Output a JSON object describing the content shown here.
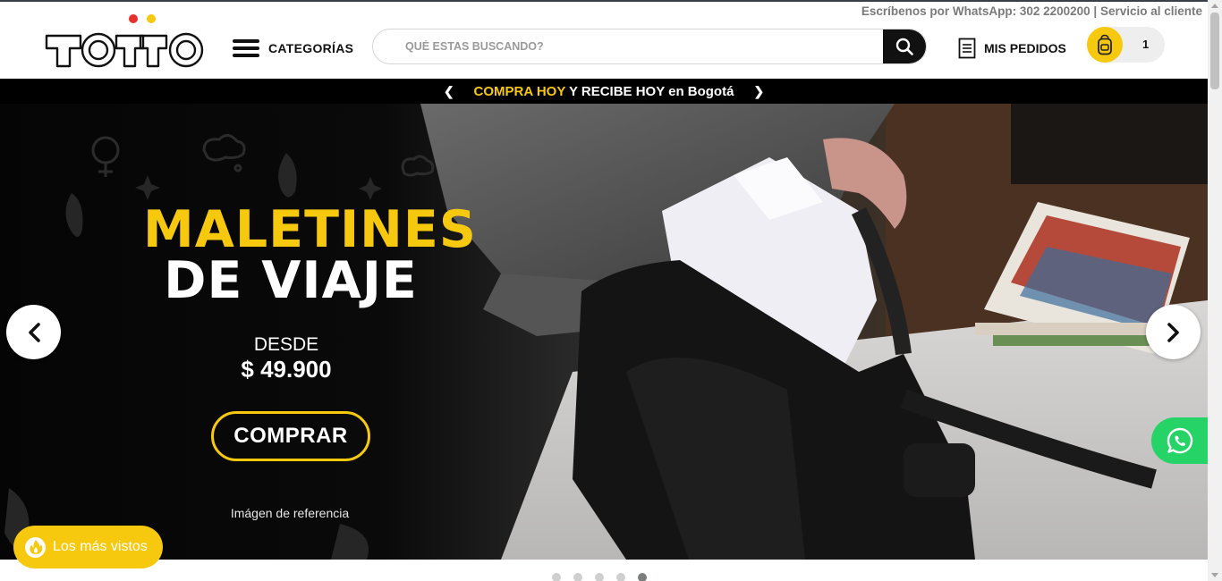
{
  "header": {
    "contact": "Escríbenos por WhatsApp: 302 2200200 | Servicio al cliente",
    "logo_text": "TOTTO",
    "categories_label": "CATEGORÍAS",
    "search_placeholder": "QUÉ ESTAS BUSCANDO?",
    "orders_label": "MIS PEDIDOS",
    "cart_count": "1"
  },
  "promo": {
    "highlight": "COMPRA HOY",
    "rest": " Y RECIBE HOY en Bogotá"
  },
  "hero": {
    "title_line1": "MALETINES",
    "title_line2": "DE VIAJE",
    "from_label": "DESDE",
    "price": "$ 49.900",
    "cta": "COMPRAR",
    "note": "Imágen de referencia"
  },
  "most_viewed": {
    "label": "Los más vistos"
  },
  "carousel": {
    "slide_count": 5,
    "active_index": 4
  },
  "colors": {
    "brand_yellow": "#f6c90e",
    "brand_red": "#e5322d",
    "whatsapp_green": "#25d366",
    "hero_dark": "#0d0d0d"
  },
  "icons": [
    "logo",
    "hamburger-icon",
    "search-icon",
    "orders-icon",
    "backpack-icon",
    "chevron-left-icon",
    "chevron-right-icon",
    "whatsapp-icon",
    "flame-icon"
  ]
}
